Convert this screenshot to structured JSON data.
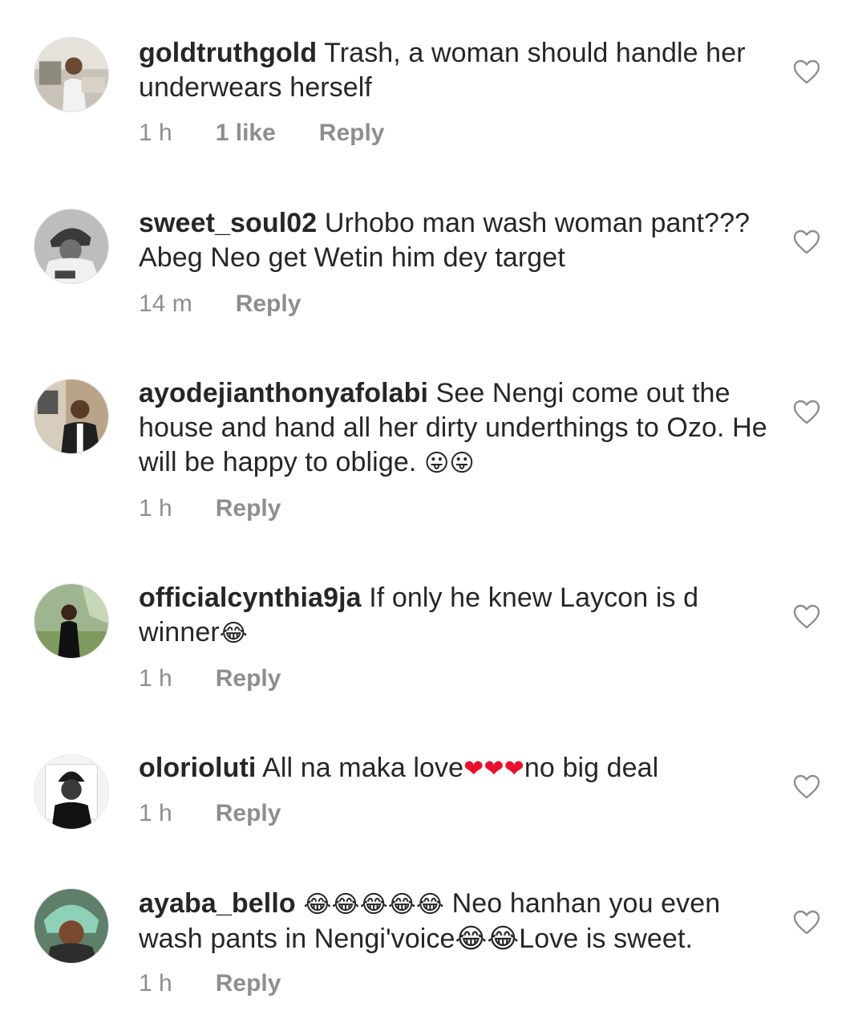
{
  "comments": [
    {
      "username": "goldtruthgold",
      "text": " Trash, a woman should handle her underwears herself",
      "emoji": "",
      "text_after": "",
      "time": "1 h",
      "likes": "1 like",
      "reply": "Reply",
      "avatar_icon": "user-photo-avatar"
    },
    {
      "username": "sweet_soul02",
      "text": " Urhobo man wash woman pant??? Abeg Neo get Wetin him dey target",
      "emoji": "",
      "text_after": "",
      "time": "14 m",
      "likes": "",
      "reply": "Reply",
      "avatar_icon": "user-photo-avatar"
    },
    {
      "username": "ayodejianthonyafolabi",
      "text": " See Nengi come out the house and hand all her dirty underthings to Ozo. He will be happy to oblige. ",
      "emoji": "😛😛",
      "text_after": "",
      "time": "1 h",
      "likes": "",
      "reply": "Reply",
      "avatar_icon": "user-photo-avatar"
    },
    {
      "username": "officialcynthia9ja",
      "text": " If only he knew Laycon is d winner",
      "emoji": "😂",
      "text_after": "",
      "time": "1 h",
      "likes": "",
      "reply": "Reply",
      "avatar_icon": "user-photo-avatar"
    },
    {
      "username": "olorioluti",
      "text": " All na maka love",
      "emoji": "❤❤❤",
      "text_after": "no big deal",
      "time": "1 h",
      "likes": "",
      "reply": "Reply",
      "avatar_icon": "user-photo-avatar"
    },
    {
      "username": "ayaba_bello",
      "text": " ",
      "emoji": "😂😂😂😂😂",
      "text_after": " Neo hanhan you even wash pants in Nengi'voice😂😂Love is sweet.",
      "time": "1 h",
      "likes": "",
      "reply": "Reply",
      "avatar_icon": "user-photo-avatar"
    }
  ],
  "colors": {
    "text": "#262626",
    "meta": "#8e8e8e",
    "heart_outline": "#8e8e8e",
    "emoji_red_heart": "#e8112d",
    "background": "#ffffff"
  },
  "icons": {
    "like": "heart-outline-icon"
  }
}
